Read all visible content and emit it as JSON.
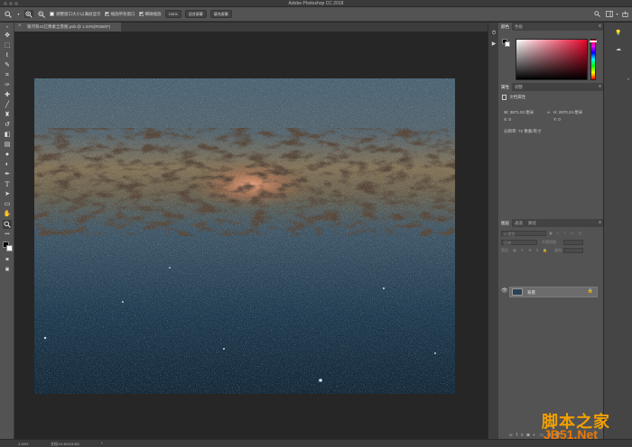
{
  "app": {
    "title": "Adobe Photoshop CC 2018"
  },
  "options_bar": {
    "resize_windows_label": "调整窗口大小以满屏显示",
    "resize_windows_checked": false,
    "zoom_all_windows_label": "缩放所有窗口",
    "zoom_all_windows_checked": true,
    "scrubby_zoom_label": "细微缩放",
    "scrubby_zoom_checked": true,
    "btn_100": "100%",
    "btn_fit_screen": "适合屏幕",
    "btn_fill_screen": "填充屏幕"
  },
  "document": {
    "tab_title": "银河系41亿像素全景图.psb @ 1.04%(RGB/8*)"
  },
  "status": {
    "zoom": "1.04%",
    "doc_size": "文档:24.6G/24.6G"
  },
  "color_panel": {
    "tabs": [
      "颜色",
      "色板"
    ],
    "hue_position": 0.02
  },
  "properties_panel": {
    "tabs": [
      "属性",
      "调整"
    ],
    "section_title": "文档属性",
    "w_label": "W:",
    "w_value": "3871.02 厘米",
    "h_label": "H:",
    "h_value": "2870.24 厘米",
    "x_label": "X:",
    "x_value": "0",
    "y_label": "Y:",
    "y_value": "0",
    "resolution": "分辨率: 72 像素/英寸"
  },
  "layers_panel": {
    "tabs": [
      "图层",
      "通道",
      "路径"
    ],
    "kind_placeholder": "Q 类型",
    "blend_mode": "正常",
    "opacity_label": "不透明度:",
    "lock_label": "锁定:",
    "fill_label": "填充:",
    "layers": [
      {
        "name": "背景",
        "visible": true,
        "locked": true
      }
    ]
  },
  "watermark": {
    "line1": "脚本之家",
    "line2": "JB51.Net"
  },
  "colors": {
    "chrome": "#535353",
    "dark_chrome": "#3a3a3a",
    "canvas_bg": "#262626",
    "layer_selected": "#6c6c6c",
    "watermark_orange": "#f3a000"
  }
}
